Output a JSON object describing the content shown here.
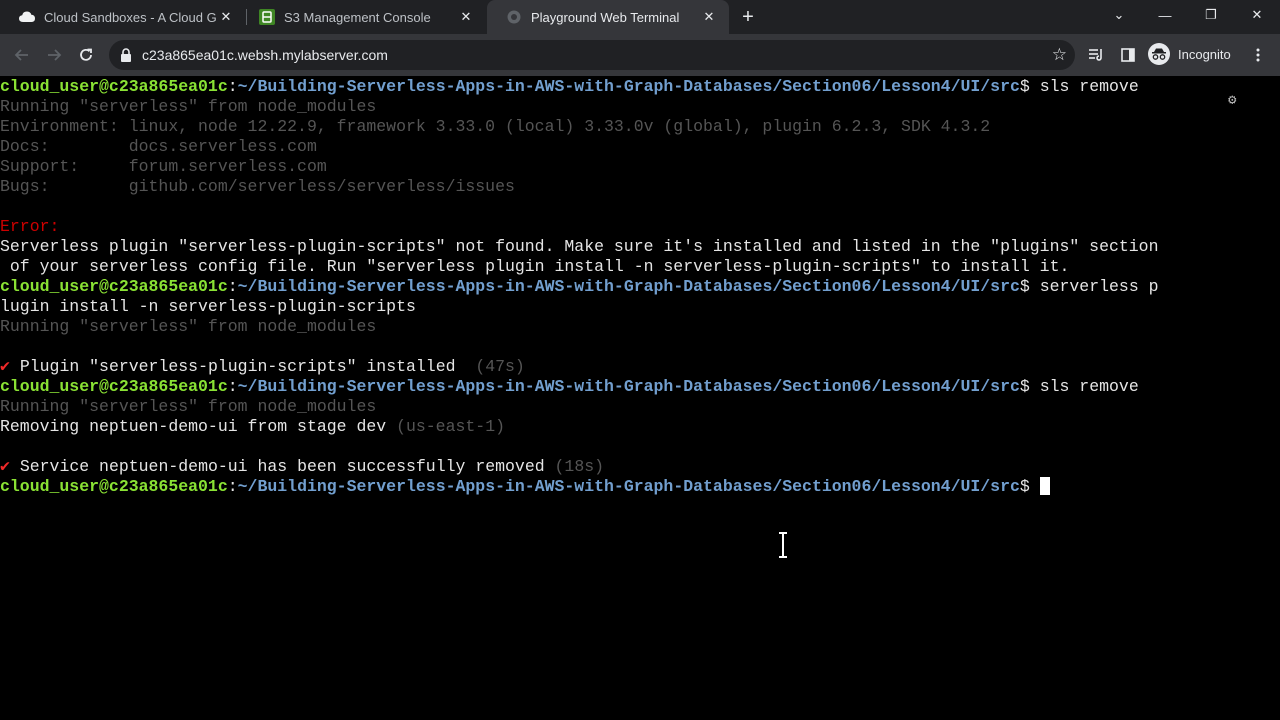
{
  "tabs": [
    {
      "title": "Cloud Sandboxes - A Cloud Guru",
      "icon": "cloud-icon",
      "close": "✕"
    },
    {
      "title": "S3 Management Console",
      "icon": "s3-icon",
      "close": "✕"
    },
    {
      "title": "Playground Web Terminal",
      "icon": "terminal-icon",
      "close": "✕"
    }
  ],
  "newtab": "+",
  "window": {
    "minimize": "—",
    "restore": "❐",
    "close": "✕",
    "tabsearch": "⌄"
  },
  "toolbar": {
    "url": "c23a865ea01c.websh.mylabserver.com",
    "profile": "Incognito"
  },
  "terminal": {
    "prompt_user": "cloud_user@c23a865ea01c",
    "prompt_path": "~/Building-Serverless-Apps-in-AWS-with-Graph-Databases/Section06/Lesson4/UI/src",
    "cmd1": " sls remove",
    "running": "Running \"serverless\" from node_modules",
    "env": "Environment: linux, node 12.22.9, framework 3.33.0 (local) 3.33.0v (global), plugin 6.2.3, SDK 4.3.2",
    "docs": "Docs:        docs.serverless.com",
    "support": "Support:     forum.serverless.com",
    "bugs": "Bugs:        github.com/serverless/serverless/issues",
    "error_label": "Error:",
    "error_line1": "Serverless plugin \"serverless-plugin-scripts\" not found. Make sure it's installed and listed in the \"plugins\" section",
    "error_line2": " of your serverless config file. Run \"serverless plugin install -n serverless-plugin-scripts\" to install it.",
    "cmd2a": " serverless p",
    "cmd2b": "lugin install -n serverless-plugin-scripts",
    "check_mark": "✔",
    "plugin_installed": " Plugin \"serverless-plugin-scripts\" installed  ",
    "plugin_time": "(47s)",
    "cmd3": " sls remove",
    "removing": "Removing neptuen-demo-ui from stage dev ",
    "region": "(us-east-1)",
    "removed": " Service neptuen-demo-ui has been successfully removed ",
    "removed_time": "(18s)",
    "dollar": "$"
  }
}
